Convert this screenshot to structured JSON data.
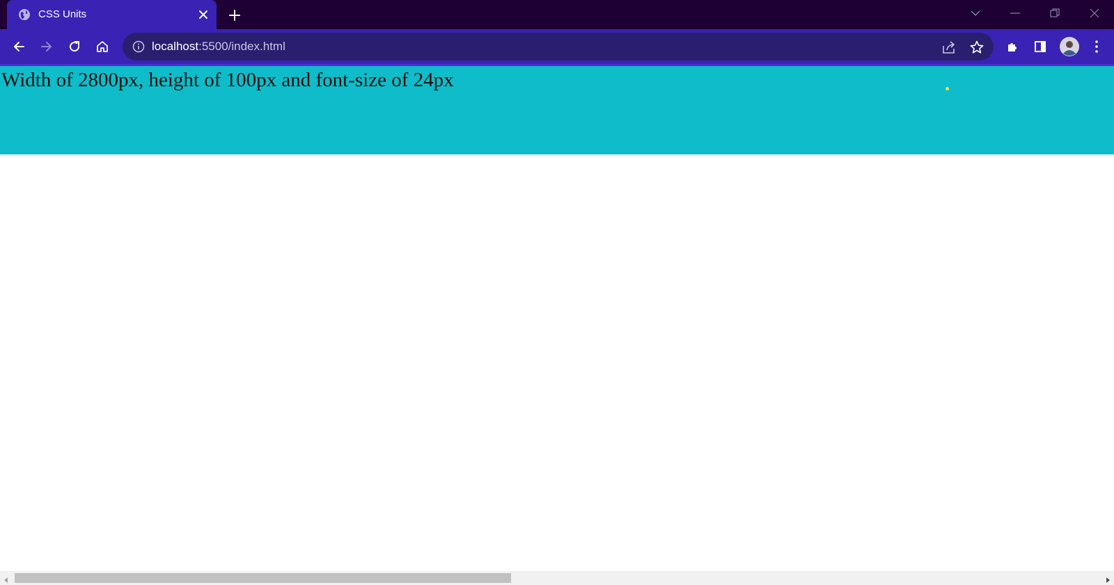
{
  "browser": {
    "tab": {
      "title": "CSS Units",
      "favicon": "globe-icon"
    },
    "toolbar": {
      "url_host": "localhost",
      "url_rest": ":5500/index.html"
    },
    "colors": {
      "tabstrip": "#1f0034",
      "active_tab": "#3a22b4",
      "toolbar": "#3a22b4",
      "omnibox": "#2a1f6e"
    }
  },
  "page": {
    "banner_text": "Width of 2800px, height of 100px and font-size of 24px",
    "banner_color": "#0fbcc9"
  }
}
